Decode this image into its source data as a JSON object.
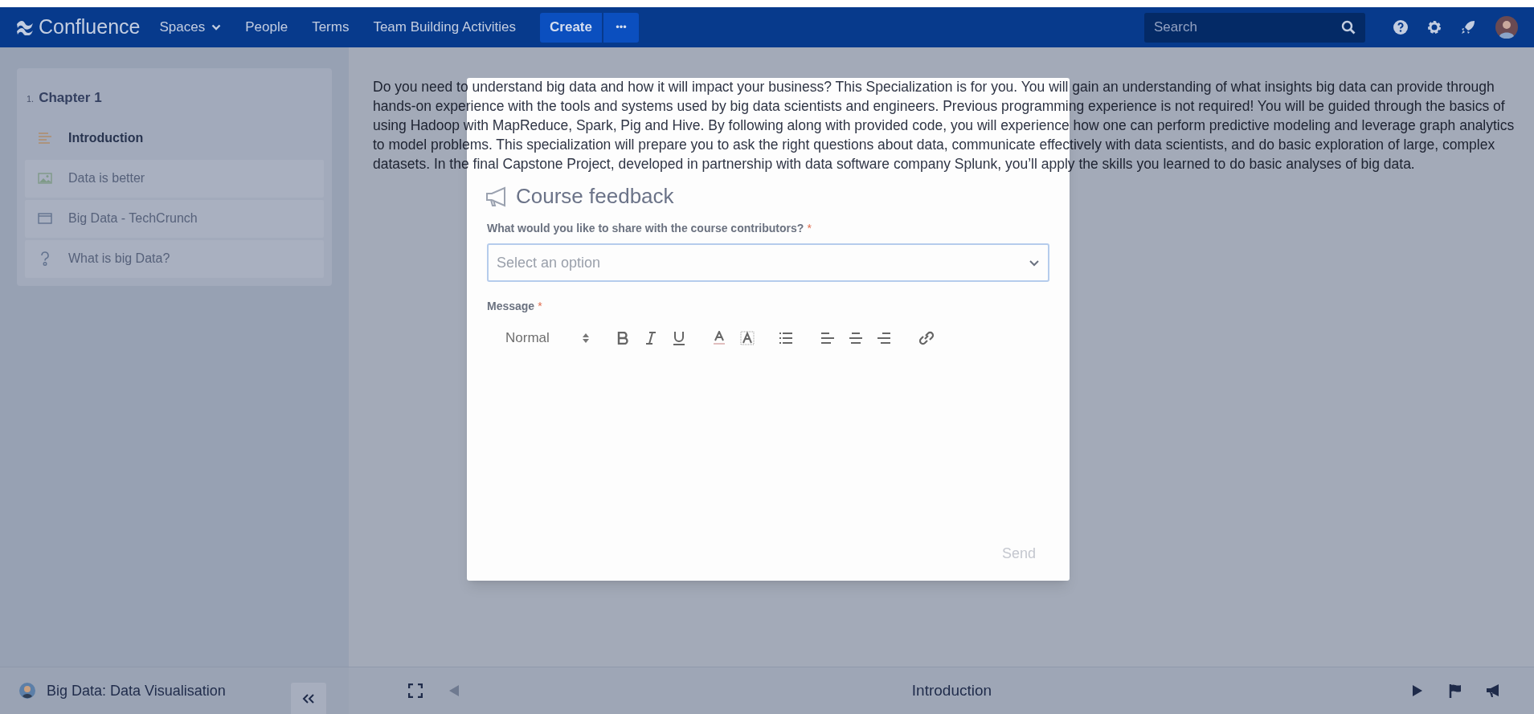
{
  "nav": {
    "logo": "Confluence",
    "links": [
      {
        "label": "Spaces",
        "dropdown": true
      },
      {
        "label": "People",
        "dropdown": false
      },
      {
        "label": "Terms",
        "dropdown": false
      },
      {
        "label": "Team Building Activities",
        "dropdown": false
      }
    ],
    "create": "Create",
    "more": "•••",
    "search": {
      "placeholder": "Search"
    }
  },
  "sidebar": {
    "chapter_number": "1.",
    "chapter": "Chapter 1",
    "items": [
      {
        "label": "Introduction",
        "kind": "text",
        "selected": true
      },
      {
        "label": "Data is better",
        "kind": "image",
        "selected": false
      },
      {
        "label": "Big Data - TechCrunch",
        "kind": "web",
        "selected": false
      },
      {
        "label": "What is big Data?",
        "kind": "quiz",
        "selected": false
      }
    ]
  },
  "content": {
    "paragraph": "Do you need to understand big data and how it will impact your business? This Specialization is for you. You will gain an understanding of what insights big data can provide through hands-on experience with the tools and systems used by big data scientists and engineers. Previous programming experience is not required! You will be guided through the basics of using Hadoop with MapReduce, Spark, Pig and Hive. By following along with provided code, you will experience how one can perform predictive modeling and leverage graph analytics to model problems. This specialization will prepare you to ask the right questions about data, communicate effectively with data scientists, and do basic exploration of large, complex datasets. In the final Capstone Project, developed in partnership with data software company Splunk, you’ll apply the skills you learned to do basic analyses of big data."
  },
  "modal": {
    "title": "Course feedback",
    "question": "What would you like to share with the course contributors?",
    "question_required": "*",
    "select": {
      "placeholder": "Select an option"
    },
    "message_label": "Message",
    "message_required": "*",
    "format": "Normal",
    "send": {
      "label": "Send",
      "disabled": true
    }
  },
  "footer": {
    "course": "Big Data: Data Visualisation",
    "page_title": "Introduction"
  }
}
